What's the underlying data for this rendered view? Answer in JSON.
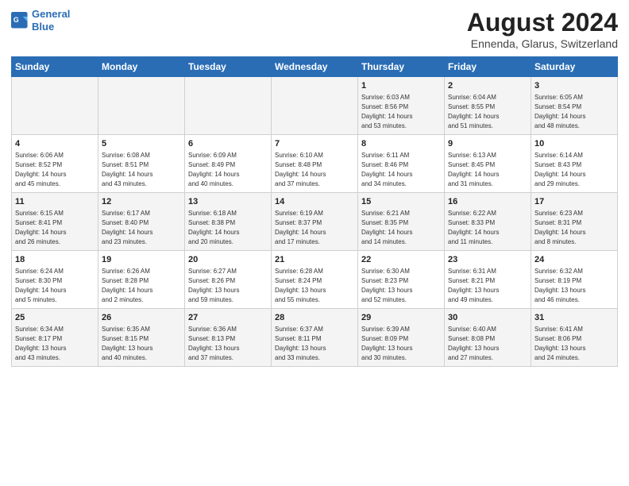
{
  "logo": {
    "line1": "General",
    "line2": "Blue"
  },
  "title": "August 2024",
  "subtitle": "Ennenda, Glarus, Switzerland",
  "days_of_week": [
    "Sunday",
    "Monday",
    "Tuesday",
    "Wednesday",
    "Thursday",
    "Friday",
    "Saturday"
  ],
  "weeks": [
    [
      {
        "day": "",
        "info": ""
      },
      {
        "day": "",
        "info": ""
      },
      {
        "day": "",
        "info": ""
      },
      {
        "day": "",
        "info": ""
      },
      {
        "day": "1",
        "info": "Sunrise: 6:03 AM\nSunset: 8:56 PM\nDaylight: 14 hours\nand 53 minutes."
      },
      {
        "day": "2",
        "info": "Sunrise: 6:04 AM\nSunset: 8:55 PM\nDaylight: 14 hours\nand 51 minutes."
      },
      {
        "day": "3",
        "info": "Sunrise: 6:05 AM\nSunset: 8:54 PM\nDaylight: 14 hours\nand 48 minutes."
      }
    ],
    [
      {
        "day": "4",
        "info": "Sunrise: 6:06 AM\nSunset: 8:52 PM\nDaylight: 14 hours\nand 45 minutes."
      },
      {
        "day": "5",
        "info": "Sunrise: 6:08 AM\nSunset: 8:51 PM\nDaylight: 14 hours\nand 43 minutes."
      },
      {
        "day": "6",
        "info": "Sunrise: 6:09 AM\nSunset: 8:49 PM\nDaylight: 14 hours\nand 40 minutes."
      },
      {
        "day": "7",
        "info": "Sunrise: 6:10 AM\nSunset: 8:48 PM\nDaylight: 14 hours\nand 37 minutes."
      },
      {
        "day": "8",
        "info": "Sunrise: 6:11 AM\nSunset: 8:46 PM\nDaylight: 14 hours\nand 34 minutes."
      },
      {
        "day": "9",
        "info": "Sunrise: 6:13 AM\nSunset: 8:45 PM\nDaylight: 14 hours\nand 31 minutes."
      },
      {
        "day": "10",
        "info": "Sunrise: 6:14 AM\nSunset: 8:43 PM\nDaylight: 14 hours\nand 29 minutes."
      }
    ],
    [
      {
        "day": "11",
        "info": "Sunrise: 6:15 AM\nSunset: 8:41 PM\nDaylight: 14 hours\nand 26 minutes."
      },
      {
        "day": "12",
        "info": "Sunrise: 6:17 AM\nSunset: 8:40 PM\nDaylight: 14 hours\nand 23 minutes."
      },
      {
        "day": "13",
        "info": "Sunrise: 6:18 AM\nSunset: 8:38 PM\nDaylight: 14 hours\nand 20 minutes."
      },
      {
        "day": "14",
        "info": "Sunrise: 6:19 AM\nSunset: 8:37 PM\nDaylight: 14 hours\nand 17 minutes."
      },
      {
        "day": "15",
        "info": "Sunrise: 6:21 AM\nSunset: 8:35 PM\nDaylight: 14 hours\nand 14 minutes."
      },
      {
        "day": "16",
        "info": "Sunrise: 6:22 AM\nSunset: 8:33 PM\nDaylight: 14 hours\nand 11 minutes."
      },
      {
        "day": "17",
        "info": "Sunrise: 6:23 AM\nSunset: 8:31 PM\nDaylight: 14 hours\nand 8 minutes."
      }
    ],
    [
      {
        "day": "18",
        "info": "Sunrise: 6:24 AM\nSunset: 8:30 PM\nDaylight: 14 hours\nand 5 minutes."
      },
      {
        "day": "19",
        "info": "Sunrise: 6:26 AM\nSunset: 8:28 PM\nDaylight: 14 hours\nand 2 minutes."
      },
      {
        "day": "20",
        "info": "Sunrise: 6:27 AM\nSunset: 8:26 PM\nDaylight: 13 hours\nand 59 minutes."
      },
      {
        "day": "21",
        "info": "Sunrise: 6:28 AM\nSunset: 8:24 PM\nDaylight: 13 hours\nand 55 minutes."
      },
      {
        "day": "22",
        "info": "Sunrise: 6:30 AM\nSunset: 8:23 PM\nDaylight: 13 hours\nand 52 minutes."
      },
      {
        "day": "23",
        "info": "Sunrise: 6:31 AM\nSunset: 8:21 PM\nDaylight: 13 hours\nand 49 minutes."
      },
      {
        "day": "24",
        "info": "Sunrise: 6:32 AM\nSunset: 8:19 PM\nDaylight: 13 hours\nand 46 minutes."
      }
    ],
    [
      {
        "day": "25",
        "info": "Sunrise: 6:34 AM\nSunset: 8:17 PM\nDaylight: 13 hours\nand 43 minutes."
      },
      {
        "day": "26",
        "info": "Sunrise: 6:35 AM\nSunset: 8:15 PM\nDaylight: 13 hours\nand 40 minutes."
      },
      {
        "day": "27",
        "info": "Sunrise: 6:36 AM\nSunset: 8:13 PM\nDaylight: 13 hours\nand 37 minutes."
      },
      {
        "day": "28",
        "info": "Sunrise: 6:37 AM\nSunset: 8:11 PM\nDaylight: 13 hours\nand 33 minutes."
      },
      {
        "day": "29",
        "info": "Sunrise: 6:39 AM\nSunset: 8:09 PM\nDaylight: 13 hours\nand 30 minutes."
      },
      {
        "day": "30",
        "info": "Sunrise: 6:40 AM\nSunset: 8:08 PM\nDaylight: 13 hours\nand 27 minutes."
      },
      {
        "day": "31",
        "info": "Sunrise: 6:41 AM\nSunset: 8:06 PM\nDaylight: 13 hours\nand 24 minutes."
      }
    ]
  ]
}
